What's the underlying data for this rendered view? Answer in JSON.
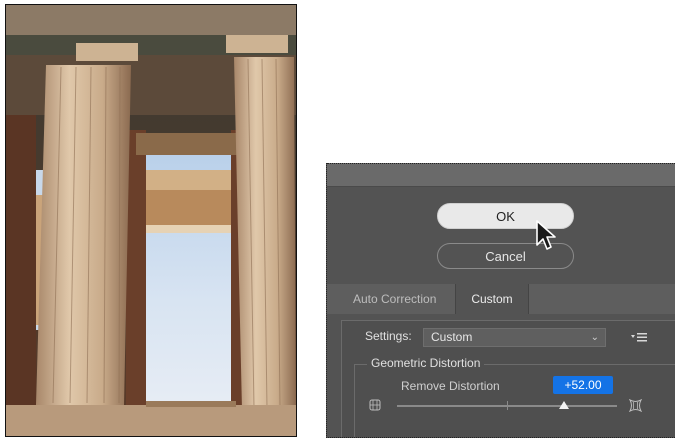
{
  "dialog": {
    "ok_label": "OK",
    "cancel_label": "Cancel",
    "tabs": [
      {
        "label": "Auto Correction"
      },
      {
        "label": "Custom"
      }
    ],
    "settings": {
      "label": "Settings:",
      "value": "Custom"
    },
    "geometric_distortion": {
      "title": "Geometric Distortion",
      "remove_distortion_label": "Remove Distortion",
      "remove_distortion_value": "+52.00",
      "slider_level_percent": 76
    }
  },
  "colors": {
    "dialog_bg": "#535353",
    "accent": "#1473e6",
    "ok_button": "#e9e9e9"
  },
  "icons": {
    "cursor": "arrow-cursor-icon",
    "panel_menu": "panel-menu-icon",
    "distortion_left": "barrel-distortion-icon",
    "distortion_right": "pincushion-distortion-icon",
    "dropdown": "chevron-down-icon"
  }
}
